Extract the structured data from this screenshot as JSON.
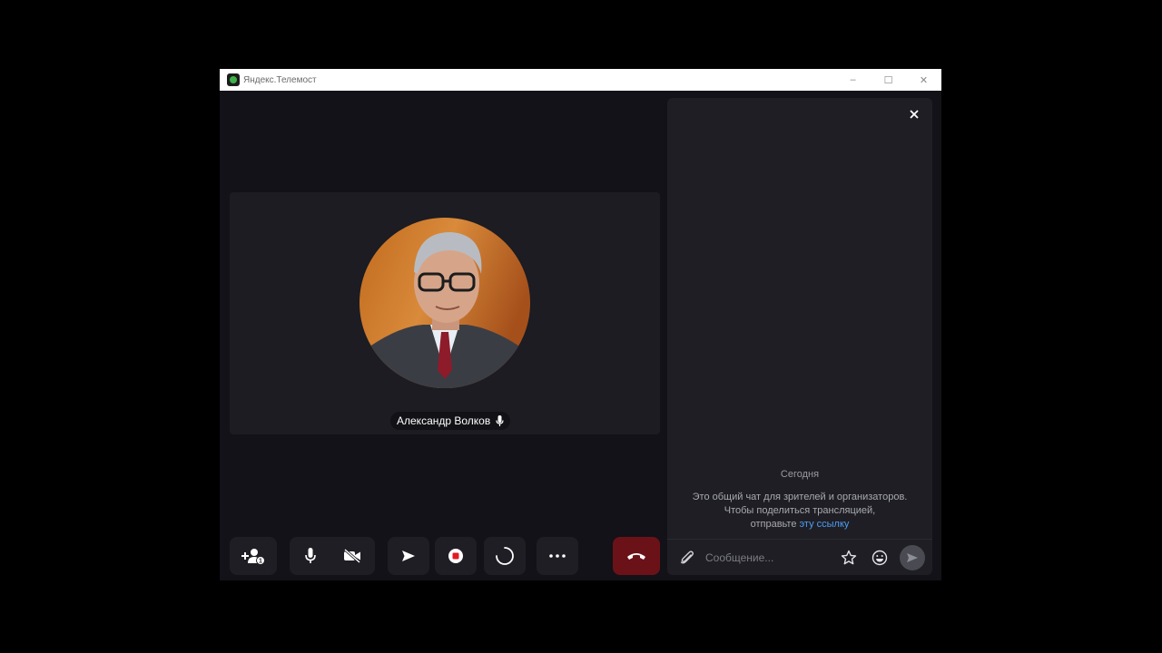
{
  "window": {
    "title": "Яндекс.Телемост",
    "minimize": "–",
    "maximize": "☐",
    "close": "✕"
  },
  "participant": {
    "name": "Александр Волков"
  },
  "chat": {
    "date_label": "Сегодня",
    "info_line1": "Это общий чат для зрителей и организаторов.",
    "info_line2": "Чтобы поделиться трансляцией,",
    "info_line3": "отправьте ",
    "info_link": "эту ссылку",
    "input_placeholder": "Сообщение..."
  },
  "colors": {
    "hangup": "#6b1218",
    "link": "#4f9ef5",
    "record": "#e01b24"
  },
  "icons": {
    "add_participant": "add-participant-icon",
    "microphone": "microphone-icon",
    "camera_off": "camera-off-icon",
    "share_screen": "share-screen-icon",
    "record": "record-icon",
    "loading": "loading-icon",
    "more": "more-icon",
    "hangup": "hangup-icon",
    "attach": "paperclip-icon",
    "star": "star-icon",
    "emoji": "emoji-icon",
    "send": "send-icon"
  }
}
